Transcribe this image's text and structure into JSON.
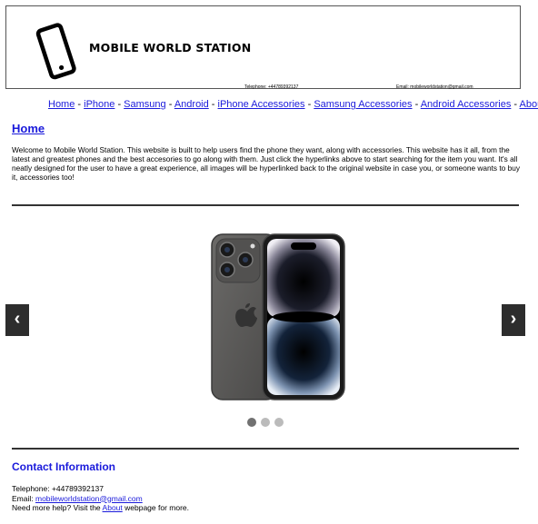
{
  "header": {
    "title": "MOBILE WORLD STATION",
    "telephone": "Telephone: +44789392137",
    "email": "Email: mobileworldstation@gmail.com",
    "logo_icon": "smartphone-icon"
  },
  "nav": {
    "items": [
      "Home",
      "iPhone",
      "Samsung",
      "Android",
      "iPhone Accessories",
      "Samsung Accessories",
      "Android Accessories",
      "About Me"
    ],
    "separator": " - "
  },
  "main": {
    "title": "Home",
    "intro": "Welcome to Mobile World Station. This website is built to help users find the phone they want, along with accessories. This website has it all, from the latest and greatest phones and the best accesories to go along with them. Just click the hyperlinks above to start searching for the item you want. It's all neatly designed for the user to have a great experience, all images will be hyperlinked back to the original website in case you, or someone wants to buy it, accessories too!"
  },
  "carousel": {
    "prev_label": "‹",
    "next_label": "›",
    "slide_count": 3,
    "active_slide": 1,
    "image_icon": "iphone-product-image"
  },
  "contact": {
    "heading": "Contact Information",
    "telephone": "Telephone: +44789392137",
    "email_prefix": "Email: ",
    "email": "mobileworldstation@gmail.com",
    "help_prefix": "Need more help? Visit the ",
    "help_link": "About",
    "help_suffix": " webpage for more."
  }
}
